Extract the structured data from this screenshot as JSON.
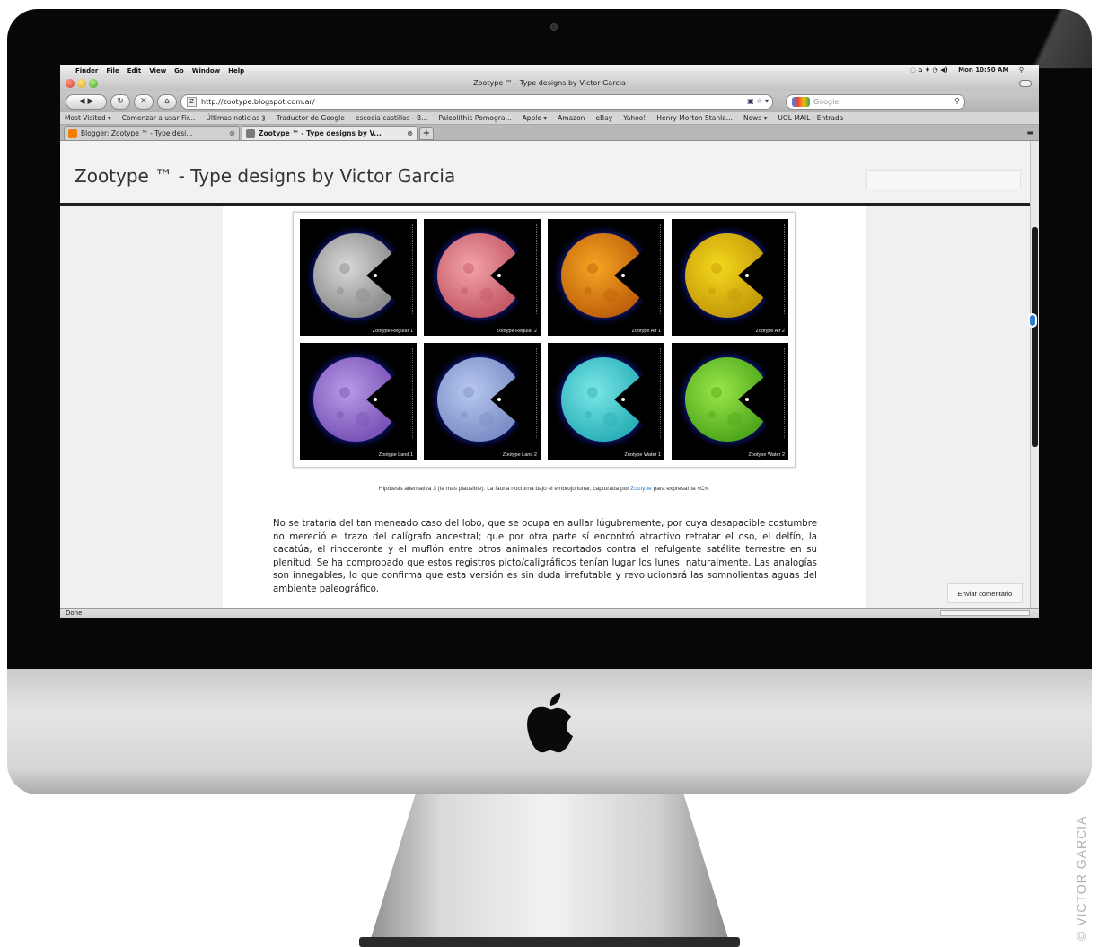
{
  "mac_menubar": {
    "items": [
      "Finder",
      "File",
      "Edit",
      "View",
      "Go",
      "Window",
      "Help"
    ],
    "clock": "Mon 10:50 AM"
  },
  "window": {
    "title": "Zootype ™ - Type designs by Victor Garcia"
  },
  "navbar": {
    "url": "http://zootype.blogspot.com.ar/",
    "search_placeholder": "Google"
  },
  "bookmarks": [
    "Most Visited ▾",
    "Comenzar a usar Fir...",
    "Últimas noticias ⟫",
    "Traductor de Google",
    "escocia castillos - B...",
    "Paleolithic Pornogra...",
    "Apple ▾",
    "Amazon",
    "eBay",
    "Yahoo!",
    "Henry Morton Stanle...",
    "News ▾",
    "UOL MAIL - Entrada"
  ],
  "tabs": [
    {
      "label": "Blogger: Zootype ™ - Type desi..."
    },
    {
      "label": "Zootype ™ - Type designs by V..."
    }
  ],
  "blog": {
    "title": "Zootype ™ - Type designs by Victor Garcia"
  },
  "tiles": [
    {
      "label": "Zootype Regular 1",
      "moon": "#d9d9d9",
      "moon_dark": "#8c8c8c"
    },
    {
      "label": "Zootype Regular 2",
      "moon": "#f3a3aa",
      "moon_dark": "#c45a66"
    },
    {
      "label": "Zootype Air 1",
      "moon": "#f5a623",
      "moon_dark": "#c0620b"
    },
    {
      "label": "Zootype Air 2",
      "moon": "#f4d81d",
      "moon_dark": "#c49a0a"
    },
    {
      "label": "Zootype Land 1",
      "moon": "#b99be6",
      "moon_dark": "#7a54b8"
    },
    {
      "label": "Zootype Land 2",
      "moon": "#b7c8f0",
      "moon_dark": "#7c8fc6"
    },
    {
      "label": "Zootype Water 1",
      "moon": "#7be6e8",
      "moon_dark": "#2bb1b8"
    },
    {
      "label": "Zootype Water 2",
      "moon": "#9be64a",
      "moon_dark": "#4fa81c"
    }
  ],
  "caption": {
    "before": "Hipótesis alternativa 3 (la más plausible): La fauna nocturna bajo el embrujo lunar, capturada por ",
    "link": "Zootype",
    "after": " para expresar la «C»."
  },
  "post_body": "No se trataría del tan meneado caso del lobo, que se ocupa en aullar lúgubremente, por cuya desapacible costumbre no mereció el trazo del calígrafo ancestral; que por otra parte sí encontró atractivo retratar el oso, el delfín, la cacatúa, el rinoceronte y el muflón entre otros animales recortados contra el refulgente satélite terrestre en su plenitud. Se ha comprobado que estos registros picto/caligráficos tenían lugar los lunes, naturalmente. Las analogías son innegables, lo que confirma que esta versión es sin duda irrefutable y revolucionará las somnolientas aguas del ambiente paleográfico.",
  "comment_button": "Enviar comentario",
  "status": "Done",
  "credit": "© VICTOR GARCIA"
}
